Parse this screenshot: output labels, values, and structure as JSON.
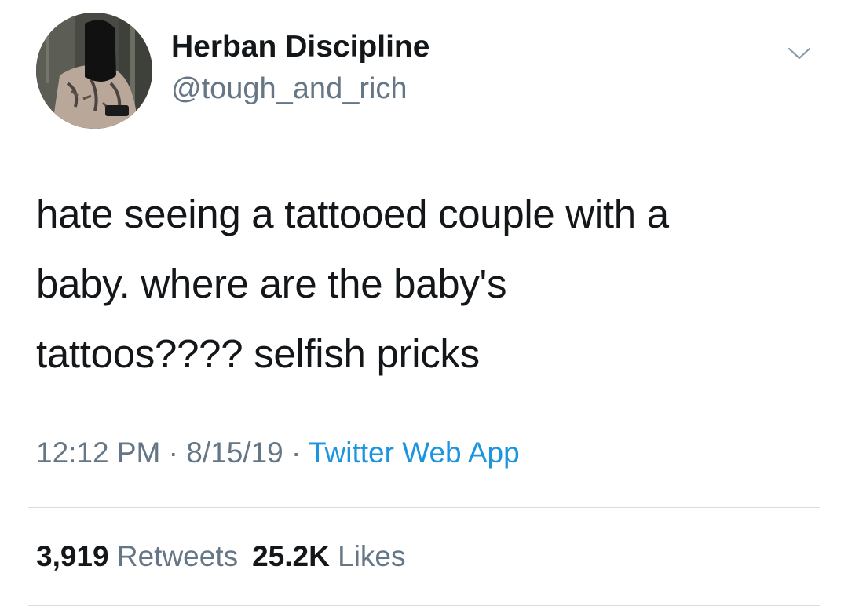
{
  "user": {
    "display_name": "Herban Discipline",
    "handle": "@tough_and_rich",
    "avatar_icon": "profile-avatar"
  },
  "menu": {
    "icon": "chevron-down-icon"
  },
  "tweet": {
    "lines": [
      "hate seeing a tattooed couple with a",
      "baby. where are the baby's",
      "tattoos???? selfish pricks"
    ]
  },
  "meta": {
    "time": "12:12 PM",
    "separator": "·",
    "date": "8/15/19",
    "source": "Twitter Web App"
  },
  "stats": {
    "retweets_count": "3,919",
    "retweets_label": "Retweets",
    "likes_count": "25.2K",
    "likes_label": "Likes"
  },
  "colors": {
    "text": "#14171a",
    "secondary": "#657786",
    "link": "#1b95e0",
    "divider": "#d8dde1"
  }
}
